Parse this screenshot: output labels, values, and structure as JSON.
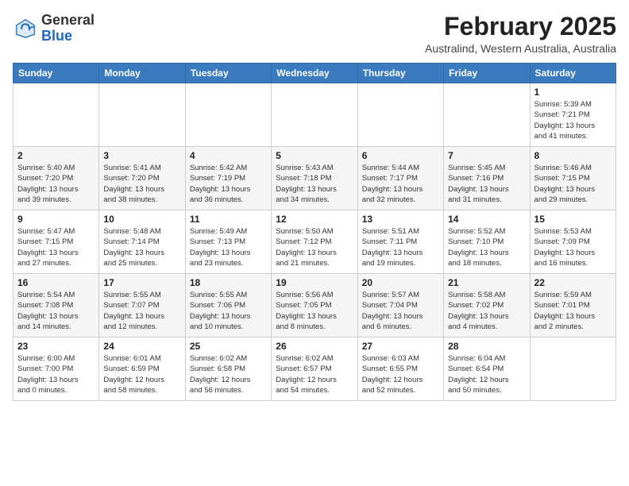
{
  "header": {
    "logo_general": "General",
    "logo_blue": "Blue",
    "month_title": "February 2025",
    "location": "Australind, Western Australia, Australia"
  },
  "weekdays": [
    "Sunday",
    "Monday",
    "Tuesday",
    "Wednesday",
    "Thursday",
    "Friday",
    "Saturday"
  ],
  "weeks": [
    [
      {
        "day": "",
        "info": ""
      },
      {
        "day": "",
        "info": ""
      },
      {
        "day": "",
        "info": ""
      },
      {
        "day": "",
        "info": ""
      },
      {
        "day": "",
        "info": ""
      },
      {
        "day": "",
        "info": ""
      },
      {
        "day": "1",
        "info": "Sunrise: 5:39 AM\nSunset: 7:21 PM\nDaylight: 13 hours\nand 41 minutes."
      }
    ],
    [
      {
        "day": "2",
        "info": "Sunrise: 5:40 AM\nSunset: 7:20 PM\nDaylight: 13 hours\nand 39 minutes."
      },
      {
        "day": "3",
        "info": "Sunrise: 5:41 AM\nSunset: 7:20 PM\nDaylight: 13 hours\nand 38 minutes."
      },
      {
        "day": "4",
        "info": "Sunrise: 5:42 AM\nSunset: 7:19 PM\nDaylight: 13 hours\nand 36 minutes."
      },
      {
        "day": "5",
        "info": "Sunrise: 5:43 AM\nSunset: 7:18 PM\nDaylight: 13 hours\nand 34 minutes."
      },
      {
        "day": "6",
        "info": "Sunrise: 5:44 AM\nSunset: 7:17 PM\nDaylight: 13 hours\nand 32 minutes."
      },
      {
        "day": "7",
        "info": "Sunrise: 5:45 AM\nSunset: 7:16 PM\nDaylight: 13 hours\nand 31 minutes."
      },
      {
        "day": "8",
        "info": "Sunrise: 5:46 AM\nSunset: 7:15 PM\nDaylight: 13 hours\nand 29 minutes."
      }
    ],
    [
      {
        "day": "9",
        "info": "Sunrise: 5:47 AM\nSunset: 7:15 PM\nDaylight: 13 hours\nand 27 minutes."
      },
      {
        "day": "10",
        "info": "Sunrise: 5:48 AM\nSunset: 7:14 PM\nDaylight: 13 hours\nand 25 minutes."
      },
      {
        "day": "11",
        "info": "Sunrise: 5:49 AM\nSunset: 7:13 PM\nDaylight: 13 hours\nand 23 minutes."
      },
      {
        "day": "12",
        "info": "Sunrise: 5:50 AM\nSunset: 7:12 PM\nDaylight: 13 hours\nand 21 minutes."
      },
      {
        "day": "13",
        "info": "Sunrise: 5:51 AM\nSunset: 7:11 PM\nDaylight: 13 hours\nand 19 minutes."
      },
      {
        "day": "14",
        "info": "Sunrise: 5:52 AM\nSunset: 7:10 PM\nDaylight: 13 hours\nand 18 minutes."
      },
      {
        "day": "15",
        "info": "Sunrise: 5:53 AM\nSunset: 7:09 PM\nDaylight: 13 hours\nand 16 minutes."
      }
    ],
    [
      {
        "day": "16",
        "info": "Sunrise: 5:54 AM\nSunset: 7:08 PM\nDaylight: 13 hours\nand 14 minutes."
      },
      {
        "day": "17",
        "info": "Sunrise: 5:55 AM\nSunset: 7:07 PM\nDaylight: 13 hours\nand 12 minutes."
      },
      {
        "day": "18",
        "info": "Sunrise: 5:55 AM\nSunset: 7:06 PM\nDaylight: 13 hours\nand 10 minutes."
      },
      {
        "day": "19",
        "info": "Sunrise: 5:56 AM\nSunset: 7:05 PM\nDaylight: 13 hours\nand 8 minutes."
      },
      {
        "day": "20",
        "info": "Sunrise: 5:57 AM\nSunset: 7:04 PM\nDaylight: 13 hours\nand 6 minutes."
      },
      {
        "day": "21",
        "info": "Sunrise: 5:58 AM\nSunset: 7:02 PM\nDaylight: 13 hours\nand 4 minutes."
      },
      {
        "day": "22",
        "info": "Sunrise: 5:59 AM\nSunset: 7:01 PM\nDaylight: 13 hours\nand 2 minutes."
      }
    ],
    [
      {
        "day": "23",
        "info": "Sunrise: 6:00 AM\nSunset: 7:00 PM\nDaylight: 13 hours\nand 0 minutes."
      },
      {
        "day": "24",
        "info": "Sunrise: 6:01 AM\nSunset: 6:59 PM\nDaylight: 12 hours\nand 58 minutes."
      },
      {
        "day": "25",
        "info": "Sunrise: 6:02 AM\nSunset: 6:58 PM\nDaylight: 12 hours\nand 56 minutes."
      },
      {
        "day": "26",
        "info": "Sunrise: 6:02 AM\nSunset: 6:57 PM\nDaylight: 12 hours\nand 54 minutes."
      },
      {
        "day": "27",
        "info": "Sunrise: 6:03 AM\nSunset: 6:55 PM\nDaylight: 12 hours\nand 52 minutes."
      },
      {
        "day": "28",
        "info": "Sunrise: 6:04 AM\nSunset: 6:54 PM\nDaylight: 12 hours\nand 50 minutes."
      },
      {
        "day": "",
        "info": ""
      }
    ]
  ]
}
